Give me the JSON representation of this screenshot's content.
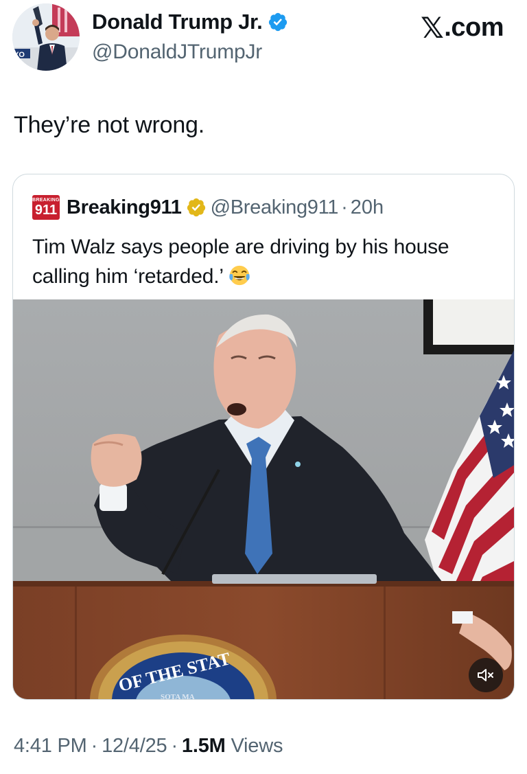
{
  "author": {
    "name": "Donald Trump Jr.",
    "handle": "@DonaldJTrumpJr",
    "verified": true,
    "verified_color": "#1d9bf0"
  },
  "brand": {
    "site": ".com",
    "glyph": "𝕏"
  },
  "tweet": {
    "text": "They’re not wrong."
  },
  "quoted": {
    "logo_top": "BREAKING",
    "logo_bottom": "911",
    "name": "Breaking911",
    "verified_color": "#e2b719",
    "handle": "@Breaking911",
    "separator": "·",
    "time": "20h",
    "text": "Tim Walz says people are driving by his house calling him ‘retarded.’",
    "emoji": "tears-of-joy-emoji",
    "media": {
      "seal_text": "OF THE STAT",
      "seal_subtext": "SOTA MA",
      "mute_icon": "muted-speaker-icon"
    }
  },
  "meta": {
    "time": "4:41 PM",
    "separator": "·",
    "date": "12/4/25",
    "views_count": "1.5M",
    "views_label": "Views"
  },
  "colors": {
    "text_primary": "#0f1419",
    "text_secondary": "#536471",
    "border": "#cfd9de",
    "breaking_red": "#c8202f"
  }
}
